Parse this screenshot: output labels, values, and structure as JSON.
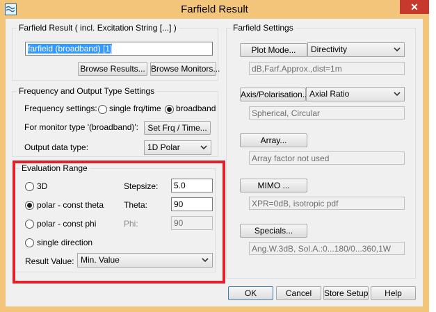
{
  "window": {
    "title": "Farfield Result",
    "close_glyph": "✕"
  },
  "farfield_result": {
    "group_title": "Farfield Result ( incl. Excitation String [...] )",
    "value": "farfield (broadband) [1]",
    "browse_results": "Browse Results...",
    "browse_monitors": "Browse Monitors..."
  },
  "freq_settings": {
    "group_title": "Frequency and Output Type Settings",
    "frequency_label": "Frequency settings:",
    "single_label": "single frq/time",
    "broadband_label": "broadband",
    "monitor_label": "For monitor type '(broadband)':",
    "set_frq_btn": "Set Frq / Time...",
    "output_label": "Output data type:",
    "output_value": "1D Polar"
  },
  "eval_range": {
    "group_title": "Evaluation Range",
    "opt_3d": "3D",
    "opt_polar_theta": "polar - const theta",
    "opt_polar_phi": "polar - const phi",
    "opt_single": "single direction",
    "stepsize_label": "Stepsize:",
    "stepsize_value": "5.0",
    "theta_label": "Theta:",
    "theta_value": "90",
    "phi_label": "Phi:",
    "phi_value": "90",
    "result_label": "Result Value:",
    "result_value": "Min. Value"
  },
  "farfield_settings": {
    "group_title": "Farfield Settings",
    "plot_mode_btn": "Plot Mode...",
    "plot_mode_value": "Directivity",
    "plot_mode_info": "dB,Farf.Approx.,dist=1m",
    "axis_btn": "Axis/Polarisation...",
    "axis_value": "Axial Ratio",
    "axis_info": "Spherical, Circular",
    "array_btn": "Array...",
    "array_info": "Array factor not used",
    "mimo_btn": "MIMO ...",
    "mimo_info": "XPR=0dB, isotropic pdf",
    "specials_btn": "Specials...",
    "specials_info": "Ang.W.3dB, Sol.A.:0...180/0...360,1W"
  },
  "footer": {
    "ok": "OK",
    "cancel": "Cancel",
    "store": "Store Setup",
    "help": "Help"
  },
  "colors": {
    "titlebar": "#f3c57a",
    "close": "#c7392d",
    "highlight": "#e0202a",
    "selection": "#3399ff"
  },
  "icons": {
    "app": "farfield-app-icon",
    "dropdown": "chevron-down-icon"
  }
}
